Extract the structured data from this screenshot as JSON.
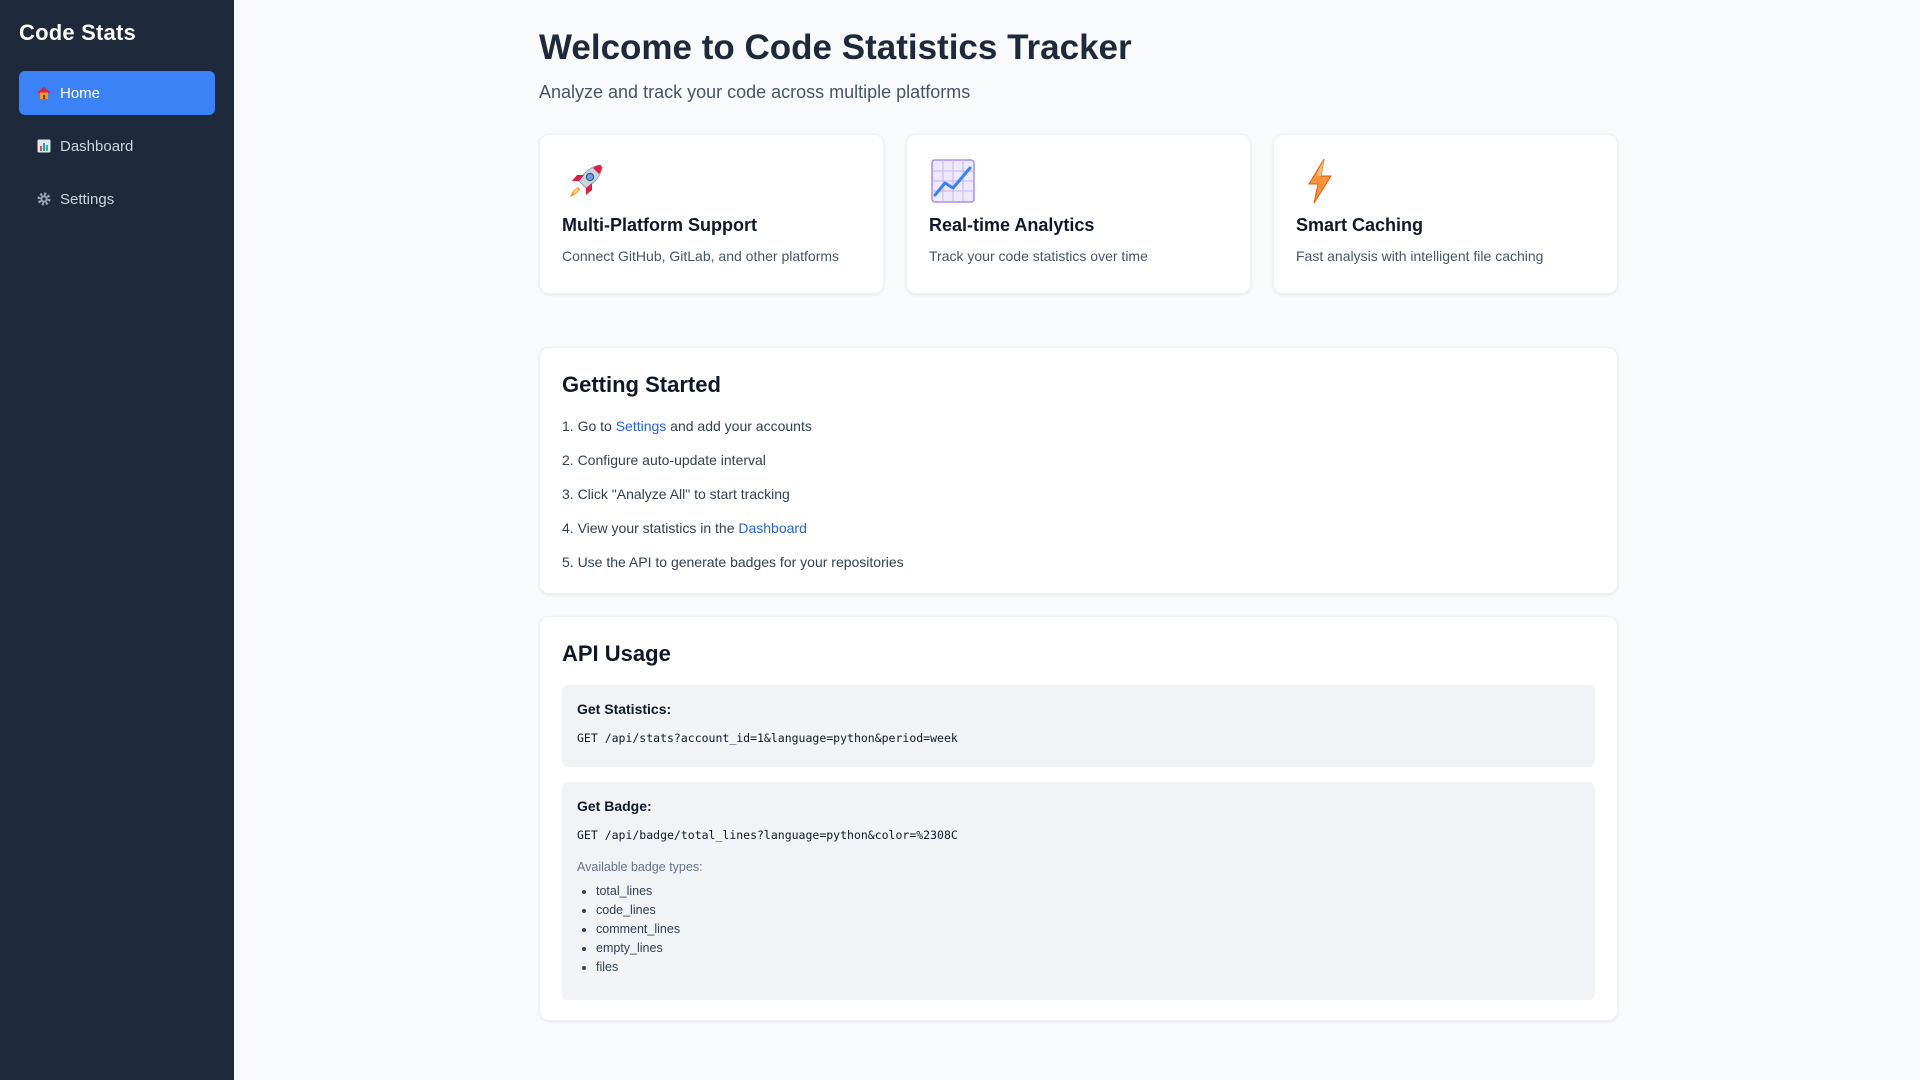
{
  "sidebar": {
    "brand": "Code Stats",
    "items": [
      {
        "label": "Home",
        "icon": "house-icon",
        "active": true
      },
      {
        "label": "Dashboard",
        "icon": "bar-chart-icon",
        "active": false
      },
      {
        "label": "Settings",
        "icon": "gear-icon",
        "active": false
      }
    ]
  },
  "header": {
    "title": "Welcome to Code Statistics Tracker",
    "subtitle": "Analyze and track your code across multiple platforms"
  },
  "features": [
    {
      "icon": "rocket-icon",
      "title": "Multi-Platform Support",
      "description": "Connect GitHub, GitLab, and other platforms"
    },
    {
      "icon": "chart-increasing-icon",
      "title": "Real-time Analytics",
      "description": "Track your code statistics over time"
    },
    {
      "icon": "lightning-icon",
      "title": "Smart Caching",
      "description": "Fast analysis with intelligent file caching"
    }
  ],
  "getting_started": {
    "title": "Getting Started",
    "step1_prefix": "1. Go to ",
    "step1_link": "Settings",
    "step1_suffix": " and add your accounts",
    "step2": "2. Configure auto-update interval",
    "step3": "3. Click \"Analyze All\" to start tracking",
    "step4_prefix": "4. View your statistics in the ",
    "step4_link": "Dashboard",
    "step5": "5. Use the API to generate badges for your repositories"
  },
  "api": {
    "title": "API Usage",
    "stats_label": "Get Statistics:",
    "stats_code": "GET /api/stats?account_id=1&language=python&period=week",
    "badge_label": "Get Badge:",
    "badge_code": "GET /api/badge/total_lines?language=python&color=%2308C",
    "badge_types_title": "Available badge types:",
    "badge_types": [
      "total_lines",
      "code_lines",
      "comment_lines",
      "empty_lines",
      "files"
    ]
  },
  "colors": {
    "sidebar_bg": "#1e293b",
    "accent": "#3b82f6",
    "link": "#2563eb",
    "page_bg": "#f8fafc"
  }
}
